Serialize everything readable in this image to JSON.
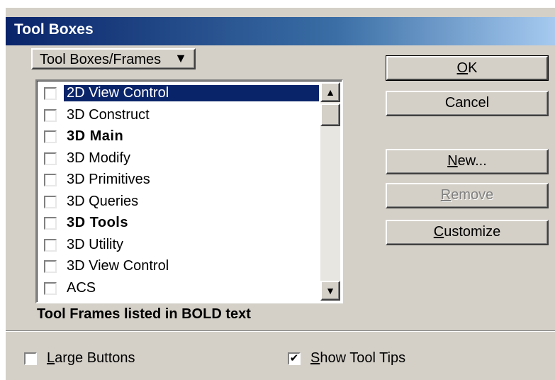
{
  "window": {
    "title": "Tool Boxes"
  },
  "dropdown": {
    "selected": "Tool Boxes/Frames"
  },
  "list": {
    "items": [
      {
        "label": "2D View Control",
        "bold": false,
        "selected": true,
        "checked": false
      },
      {
        "label": "3D Construct",
        "bold": false,
        "selected": false,
        "checked": false
      },
      {
        "label": "3D Main",
        "bold": true,
        "selected": false,
        "checked": false
      },
      {
        "label": "3D Modify",
        "bold": false,
        "selected": false,
        "checked": false
      },
      {
        "label": "3D Primitives",
        "bold": false,
        "selected": false,
        "checked": false
      },
      {
        "label": "3D Queries",
        "bold": false,
        "selected": false,
        "checked": false
      },
      {
        "label": "3D Tools",
        "bold": true,
        "selected": false,
        "checked": false
      },
      {
        "label": "3D Utility",
        "bold": false,
        "selected": false,
        "checked": false
      },
      {
        "label": "3D View Control",
        "bold": false,
        "selected": false,
        "checked": false
      },
      {
        "label": "ACS",
        "bold": false,
        "selected": false,
        "checked": false
      }
    ],
    "footnote": "Tool Frames listed in BOLD text"
  },
  "buttons": {
    "ok": {
      "mnemonic": "O",
      "rest": "K"
    },
    "cancel": {
      "label": "Cancel"
    },
    "new": {
      "mnemonic": "N",
      "rest": "ew..."
    },
    "remove": {
      "mnemonic": "R",
      "rest": "emove"
    },
    "customize": {
      "mnemonic": "C",
      "rest": "ustomize"
    }
  },
  "options": {
    "large_buttons": {
      "mnemonic": "L",
      "rest": "arge Buttons",
      "checked": false
    },
    "show_tool_tips": {
      "mnemonic": "S",
      "rest": "how Tool Tips",
      "checked": true,
      "check_glyph": "✔"
    }
  },
  "colors": {
    "title_start": "#0a246a",
    "title_end": "#a6caf0",
    "selection": "#0a246a",
    "face": "#d4d0c8"
  },
  "icons": {
    "dropdown": "chevron-down-icon",
    "scroll_up": "scroll-up-icon",
    "scroll_down": "scroll-down-icon",
    "scroll_up_glyph": "▲",
    "scroll_down_glyph": "▼",
    "dropdown_glyph": "▼"
  }
}
